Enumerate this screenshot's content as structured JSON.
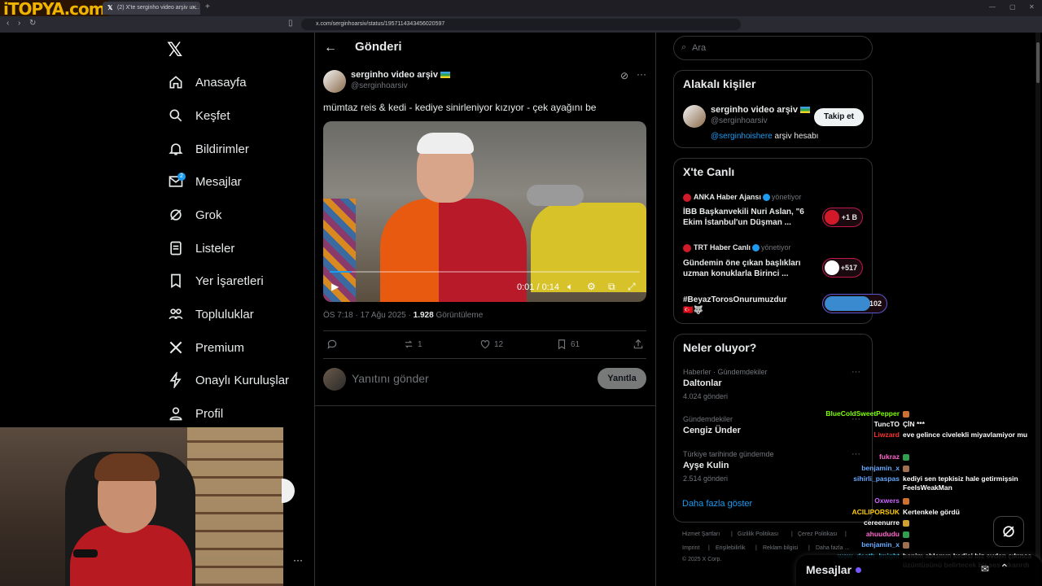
{
  "browser": {
    "brand": "iTOPYA.com",
    "tab_title": "(2) X'te serginho video arşiv ur...",
    "url": "x.com/serginhoarsiv/status/1957114343456020597"
  },
  "nav": {
    "items": [
      {
        "label": "Anasayfa",
        "icon": "home-icon"
      },
      {
        "label": "Keşfet",
        "icon": "search-icon"
      },
      {
        "label": "Bildirimler",
        "icon": "bell-icon"
      },
      {
        "label": "Mesajlar",
        "icon": "mail-icon",
        "badge": "2"
      },
      {
        "label": "Grok",
        "icon": "grok-icon"
      },
      {
        "label": "Listeler",
        "icon": "list-icon"
      },
      {
        "label": "Yer İşaretleri",
        "icon": "bookmark-icon"
      },
      {
        "label": "Topluluklar",
        "icon": "communities-icon"
      },
      {
        "label": "Premium",
        "icon": "x-icon"
      },
      {
        "label": "Onaylı Kuruluşlar",
        "icon": "lightning-icon"
      },
      {
        "label": "Profil",
        "icon": "person-icon"
      }
    ]
  },
  "post": {
    "header": "Gönderi",
    "author_name": "serginho video arşiv",
    "author_handle": "@serginhoarsiv",
    "text": "mümtaz reis & kedi - kediye sinirleniyor kızıyor - çek ayağını be",
    "video_time": "0:01 / 0:14",
    "video_progress": 0.07,
    "timestamp": "ÖS 7:18 · 17 Ağu 2025 · ",
    "views": "1.928",
    "views_label": " Görüntüleme",
    "retweets": "1",
    "likes": "12",
    "bookmarks": "61",
    "reply_placeholder": "Yanıtını gönder",
    "reply_button": "Yanıtla"
  },
  "right": {
    "search_placeholder": "Ara",
    "related_title": "Alakalı kişiler",
    "related": {
      "name": "serginho video arşiv",
      "handle": "@serginhoarsiv",
      "bio_mention": "@serginhoishere",
      "bio_rest": " arşiv hesabı",
      "follow": "Takip et"
    },
    "live_title": "X'te Canlı",
    "live": [
      {
        "source": "ANKA Haber Ajansı",
        "role": "yönetiyor",
        "headline": "İBB Başkanvekili Nuri Aslan, \"6 Ekim İstanbul'un Düşman ...",
        "count": "+1 B"
      },
      {
        "source": "TRT Haber Canlı",
        "role": "yönetiyor",
        "headline": "Gündemin öne çıkan başlıkları uzman konuklarla Birinci ...",
        "count": "+517"
      },
      {
        "source": "",
        "role": "",
        "headline": "#BeyazTorosOnurumuzdur🇹🇷🐺",
        "count": "+102"
      }
    ],
    "trends_title": "Neler oluyor?",
    "trends": [
      {
        "category": "Haberler · Gündemdekiler",
        "name": "Daltonlar",
        "count": "4.024 gönderi"
      },
      {
        "category": "Gündemdekiler",
        "name": "Cengiz Ünder",
        "count": ""
      },
      {
        "category": "Türkiye tarihinde gündemde",
        "name": "Ayşe Kulin",
        "count": "2.514 gönderi"
      }
    ],
    "show_more": "Daha fazla göster",
    "footer": [
      "Hizmet Şartları",
      "|",
      "Gizlilik Politikası",
      "|",
      "Çerez Politikası",
      "|",
      "Imprint",
      "|",
      "Erişilebilirlik",
      "|",
      "Reklam bilgisi",
      "|",
      "Daha fazla ...",
      "© 2025 X Corp."
    ]
  },
  "chat": [
    {
      "user": "BlueColdSweetPepper",
      "color": "#7fff00",
      "msg": ""
    },
    {
      "user": "TuncTO",
      "color": "#ffffff",
      "msg": "ÇİN ***"
    },
    {
      "user": "Liwzard",
      "color": "#ff3030",
      "msg": "eve gelince civelekli miyavlamiyor mu"
    },
    {
      "user": "fukraz",
      "color": "#ff66cc",
      "msg": ""
    },
    {
      "user": "benjamin_x",
      "color": "#66aaff",
      "msg": ""
    },
    {
      "user": "sihirli_paspas",
      "color": "#66aaff",
      "msg": "kediyi sen tepkisiz hale getirmişsin FeelsWeakMan"
    },
    {
      "user": "Oxwers",
      "color": "#cc66ff",
      "msg": ""
    },
    {
      "user": "ACILIPORSUK",
      "color": "#ffcc00",
      "msg": "Kertenkele gördü"
    },
    {
      "user": "cereenurre",
      "color": "#ffffff",
      "msg": ""
    },
    {
      "user": "ahuududu",
      "color": "#ff66cc",
      "msg": ""
    },
    {
      "user": "benjamin_x",
      "color": "#66aaff",
      "msg": ""
    },
    {
      "user": "wow_death_knight",
      "color": "#33ccff",
      "msg": "benim ablamın kedisi biz evden çıkınca üzüntüsünü belirtecek bir ses çıkarırdı"
    }
  ],
  "messages_drawer": {
    "title": "Mesajlar"
  },
  "colors": {
    "accent": "#1d9bf0",
    "live": "#c0184a",
    "brand": "#f0b400"
  }
}
